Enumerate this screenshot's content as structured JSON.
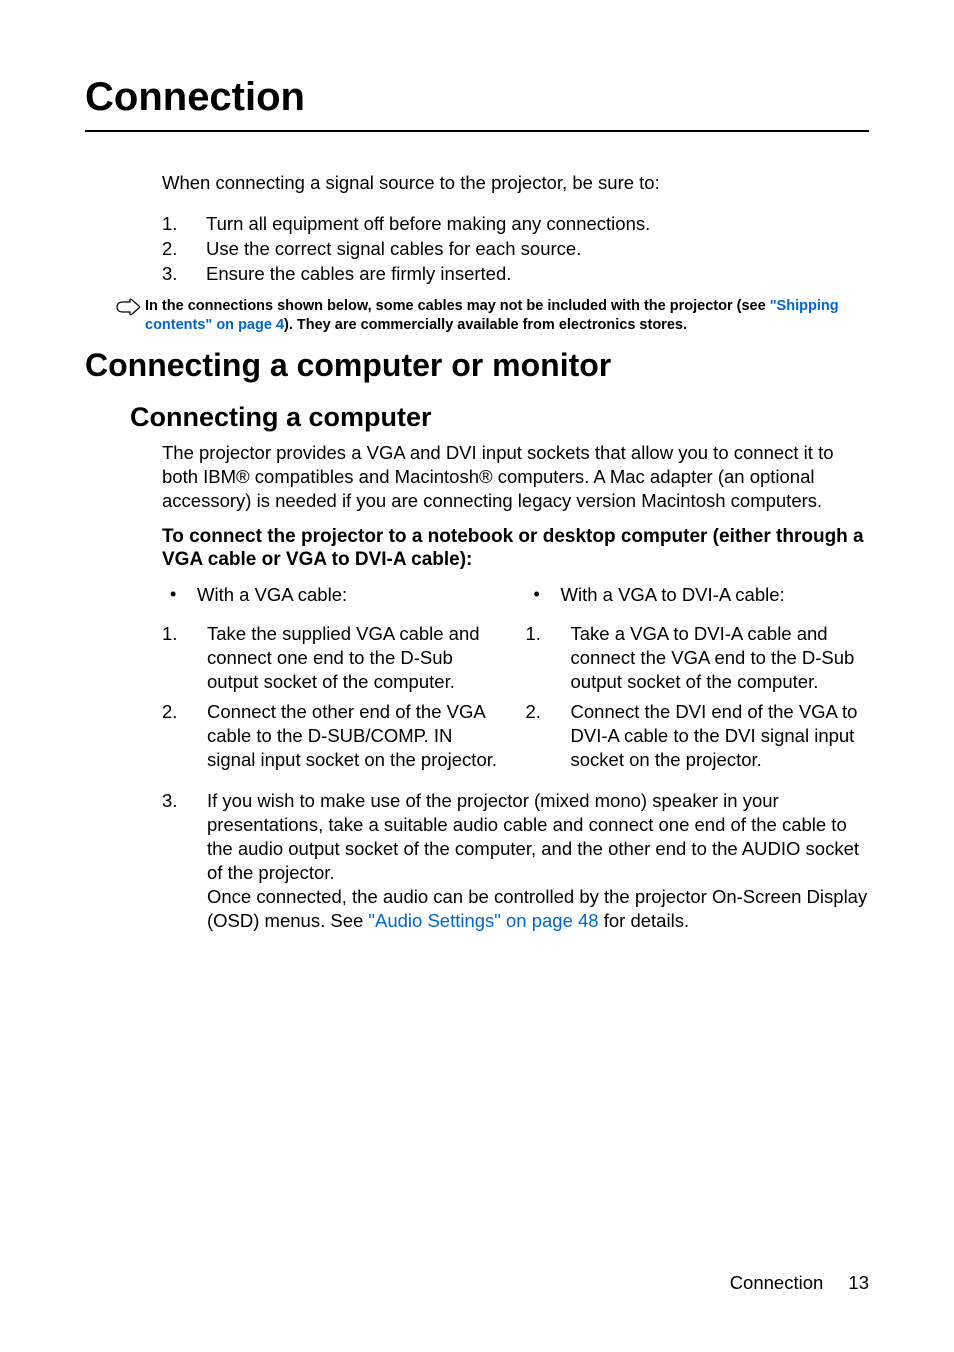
{
  "page": {
    "title": "Connection",
    "intro": "When connecting a signal source to the projector, be sure to:",
    "introList": [
      {
        "n": "1.",
        "text": "Turn all equipment off before making any connections."
      },
      {
        "n": "2.",
        "text": "Use the correct signal cables for each source."
      },
      {
        "n": "3.",
        "text": "Ensure the cables are firmly inserted."
      }
    ],
    "note": {
      "prefix": "In the connections shown below, some cables may not be included with the projector (see ",
      "link": "\"Shipping contents\" on page 4",
      "suffix": "). They are commercially available from electronics stores."
    },
    "h2": "Connecting a computer or monitor",
    "h3": "Connecting a computer",
    "para1": "The projector provides a VGA and DVI input sockets that allow you to connect it to both IBM® compatibles and Macintosh® computers. A Mac adapter (an optional accessory) is needed if you are connecting legacy version Macintosh computers.",
    "subheading": "To connect the projector to a notebook or desktop computer (either through a VGA cable or VGA to DVI-A cable):",
    "left": {
      "bullet": "With a VGA cable:",
      "steps": [
        {
          "n": "1.",
          "text": "Take the supplied VGA cable and connect one end to the D-Sub output socket of the computer."
        },
        {
          "n": "2.",
          "text": "Connect the other end of the VGA cable to the D-SUB/COMP. IN signal input socket on the projector."
        }
      ]
    },
    "right": {
      "bullet": "With a VGA to DVI-A cable:",
      "steps": [
        {
          "n": "1.",
          "text": "Take a VGA to DVI-A cable and connect the VGA end to the D-Sub output socket of the computer."
        },
        {
          "n": "2.",
          "text": "Connect the DVI end of the VGA to DVI-A cable to the DVI signal input socket on the projector."
        }
      ]
    },
    "step3": {
      "n": "3.",
      "para1": "If you wish to make use of the projector (mixed mono) speaker in your presentations, take a suitable audio cable and connect one end of the cable to the audio output socket of the computer, and the other end to the AUDIO socket of the projector.",
      "para2_prefix": "Once connected, the audio can be controlled by the projector On-Screen Display (OSD) menus. See ",
      "para2_link": "\"Audio Settings\" on page 48",
      "para2_suffix": " for details."
    },
    "footer": {
      "label": "Connection",
      "pageNumber": "13"
    }
  }
}
